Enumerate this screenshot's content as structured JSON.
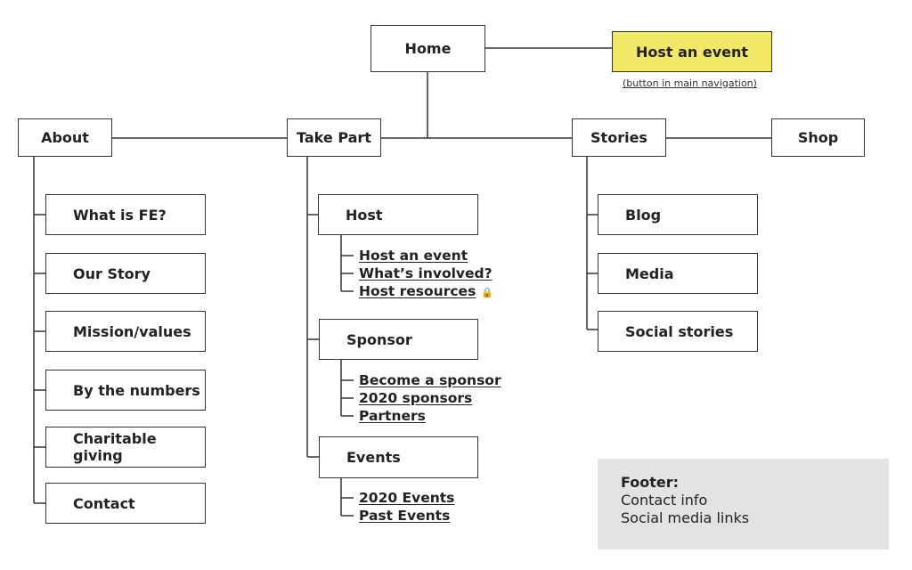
{
  "home": "Home",
  "host_cta": {
    "label": "Host an event",
    "caption": "(button in main navigation)",
    "color": "#f2e865"
  },
  "sections": {
    "about": {
      "label": "About",
      "children": [
        "What is FE?",
        "Our Story",
        "Mission/values",
        "By the numbers",
        "Charitable giving",
        "Contact"
      ]
    },
    "take_part": {
      "label": "Take Part",
      "groups": [
        {
          "label": "Host",
          "links": [
            "Host an event",
            "What’s involved?",
            "Host resources"
          ]
        },
        {
          "label": "Sponsor",
          "links": [
            "Become a sponsor",
            "2020 sponsors",
            "Partners"
          ]
        },
        {
          "label": "Events",
          "links": [
            "2020 Events",
            "Past Events"
          ]
        }
      ],
      "locked_icon": "lock-icon"
    },
    "stories": {
      "label": "Stories",
      "children": [
        "Blog",
        "Media",
        "Social stories"
      ]
    },
    "shop": {
      "label": "Shop"
    }
  },
  "footer": {
    "title": "Footer:",
    "lines": [
      "Contact info",
      "Social media links"
    ],
    "color": "#e3e3e1"
  }
}
